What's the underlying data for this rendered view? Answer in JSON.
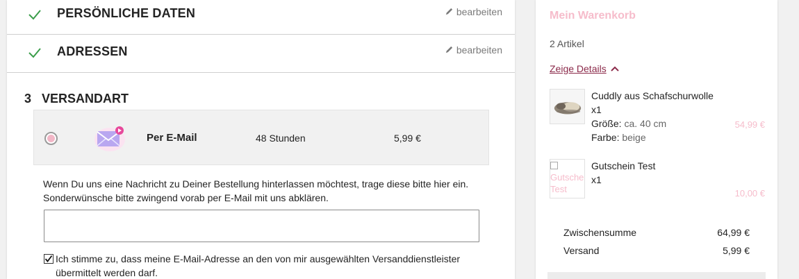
{
  "steps": {
    "personal": {
      "title": "PERSÖNLICHE DATEN",
      "edit_label": "bearbeiten"
    },
    "address": {
      "title": "ADRESSEN",
      "edit_label": "bearbeiten"
    },
    "shipping": {
      "number": "3",
      "title": "VERSANDART"
    }
  },
  "shipping_option": {
    "name": "Per E-Mail",
    "time": "48 Stunden",
    "price": "5,99 €",
    "icon": "email-icon"
  },
  "message": {
    "text": "Wenn Du uns eine Nachricht zu Deiner Bestellung hinterlassen möchtest, trage diese bitte hier ein. Sonderwünsche bitte zwingend vorab per E-Mail mit uns abklären.",
    "value": "",
    "placeholder": ""
  },
  "consent": {
    "checked": true,
    "text": "Ich stimme zu, dass meine E-Mail-Adresse an den von mir ausgewählten Versanddienstleister übermittelt werden darf."
  },
  "cart": {
    "title": "Mein Warenkorb",
    "count": "2 Artikel",
    "details_label": "Zeige Details",
    "items": [
      {
        "name": "Cuddly aus Schafschurwolle",
        "qty": "x1",
        "attrs": [
          {
            "label": "Größe:",
            "value": "ca. 40 cm"
          },
          {
            "label": "Farbe:",
            "value": "beige"
          }
        ],
        "price": "54,99 €"
      },
      {
        "name": "Gutschein Test",
        "qty": "x1",
        "image_alt": "Gutschein Test",
        "price": "10,00 €"
      }
    ],
    "totals": [
      {
        "label": "Zwischensumme",
        "value": "64,99 €"
      },
      {
        "label": "Versand",
        "value": "5,99 €"
      }
    ]
  },
  "colors": {
    "accent_pink": "#f6bccb",
    "check_green": "#3a9d4a",
    "details_link": "#8b2a4a"
  }
}
